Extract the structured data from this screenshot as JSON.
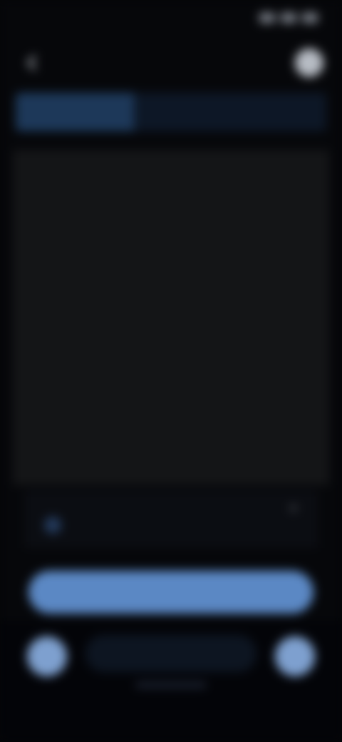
{
  "status_bar": {
    "time": "",
    "icons": [
      "signal-icon",
      "wifi-icon",
      "battery-icon"
    ]
  },
  "header": {
    "title": "",
    "back_icon": "chevron-left-icon",
    "action_icon": "profile-icon"
  },
  "progress": {
    "label": "",
    "fraction": 0.38
  },
  "word_list": [
    {
      "text": ""
    },
    {
      "text": ""
    },
    {
      "text": ""
    },
    {
      "text": ""
    },
    {
      "text": ""
    },
    {
      "text": ""
    }
  ],
  "info_row": {
    "text": "",
    "icon": "info-icon",
    "close_icon": "close-icon"
  },
  "primary_button": {
    "label": ""
  },
  "bottom": {
    "left_button_icon": "mic-icon",
    "right_button_icon": "send-icon",
    "pill_label": ""
  },
  "colors": {
    "accent": "#5b88c4",
    "background": "#06070a",
    "card": "#141517"
  }
}
